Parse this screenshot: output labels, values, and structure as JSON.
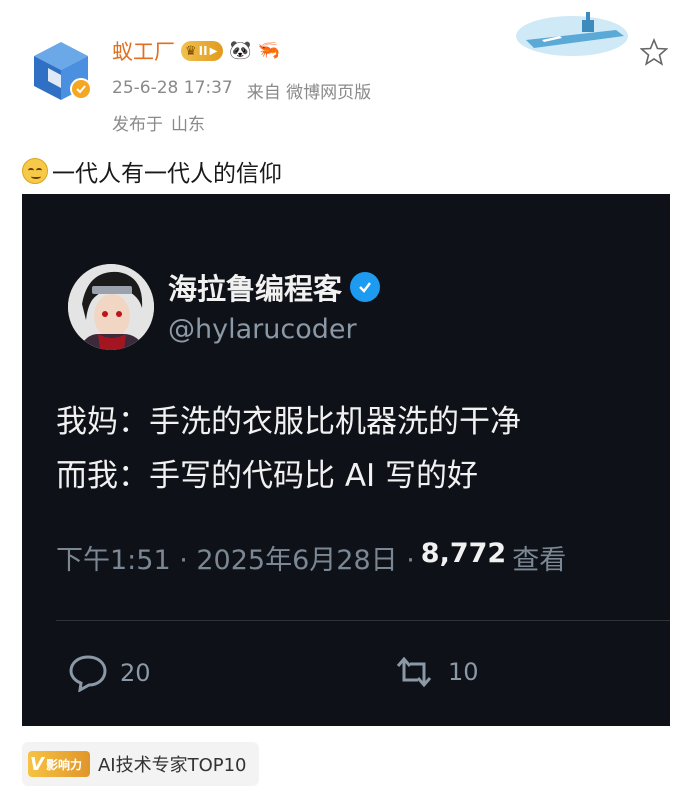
{
  "post": {
    "username": "蚁工厂",
    "level_badge": "II",
    "emoji_badges": [
      "🐼",
      "🦐"
    ],
    "timestamp": "25-6-28 17:37",
    "source": "来自 微博网页版",
    "location_prefix": "发布于",
    "location": "山东",
    "text": "一代人有一代人的信仰",
    "colors": {
      "username": "#e07020",
      "meta": "#8a8a8a",
      "verified_badge": "#f5a623"
    }
  },
  "tweet": {
    "display_name": "海拉鲁编程客",
    "handle": "@hylarucoder",
    "line1": "我妈：手洗的衣服比机器洗的干净",
    "line2": "而我：手写的代码比 AI 写的好",
    "time": "下午1:51 · 2025年6月28日 ·",
    "views": "8,772",
    "views_label": "查看",
    "replies": "20",
    "retweets": "10",
    "colors": {
      "background": "#0e1117",
      "text": "#e7e9ea",
      "muted": "#7b8793",
      "verified": "#1d9bf0"
    }
  },
  "influence": {
    "badge_text": "影响力",
    "label": "AI技术专家TOP10"
  },
  "icons": {
    "avatar": "blue-cube-logo-icon",
    "verified": "check-badge-icon",
    "favorite": "star-outline-icon",
    "reply": "comment-bubble-icon",
    "retweet": "retweet-arrows-icon",
    "emoji": "smirk-face-icon"
  }
}
